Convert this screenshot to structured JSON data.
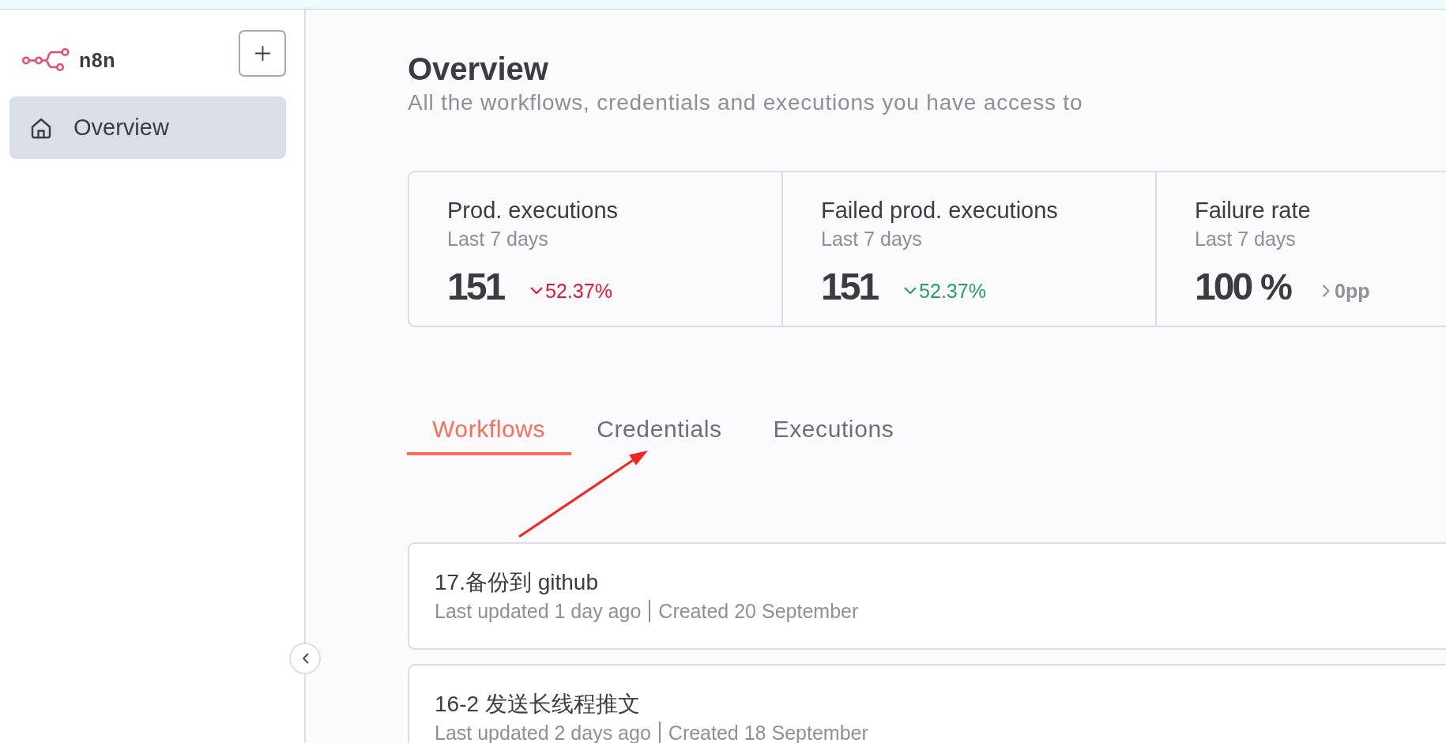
{
  "sidebar": {
    "app_name": "n8n",
    "items": [
      {
        "label": "Overview",
        "selected": true
      }
    ]
  },
  "header": {
    "title": "Overview",
    "subtitle": "All the workflows, credentials and executions you have access to"
  },
  "stats": [
    {
      "title": "Prod. executions",
      "period": "Last 7 days",
      "value": "151",
      "change": "52.37%",
      "kind": "down",
      "color": "#e4162f"
    },
    {
      "title": "Failed prod. executions",
      "period": "Last 7 days",
      "value": "151",
      "change": "52.37%",
      "kind": "down",
      "color": "#24a05e"
    },
    {
      "title": "Failure rate",
      "period": "Last 7 days",
      "value": "100",
      "unit": "%",
      "change": "0pp",
      "kind": "flat",
      "color": "#8e8f98"
    }
  ],
  "tabs": [
    {
      "label": "Workflows",
      "selected": true
    },
    {
      "label": "Credentials",
      "selected": false
    },
    {
      "label": "Executions",
      "selected": false
    }
  ],
  "workflows": [
    {
      "name": "17.备份到 github",
      "updated": "Last updated 1 day ago",
      "created": "Created 20 September"
    },
    {
      "name": "16-2 发送长线程推文",
      "updated": "Last updated 2 days ago",
      "created": "Created 18 September"
    }
  ]
}
